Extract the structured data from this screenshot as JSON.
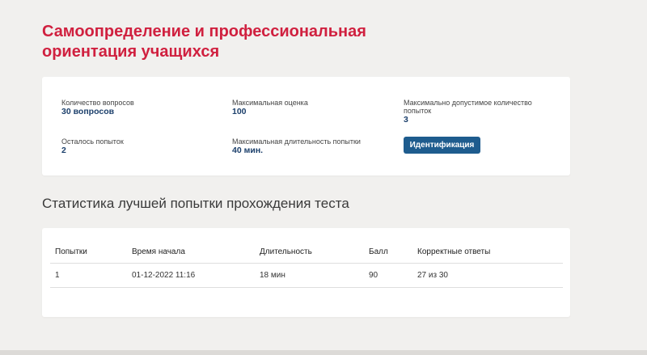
{
  "page": {
    "title": "Самоопределение и профессиональная ориентация учащихся"
  },
  "test_info": {
    "question_count": {
      "label": "Количество вопросов",
      "value": "30 вопросов"
    },
    "max_score": {
      "label": "Максимальная оценка",
      "value": "100"
    },
    "max_attempts": {
      "label": "Максимально допустимое количество попыток",
      "value": "3"
    },
    "attempts_left": {
      "label": "Осталось попыток",
      "value": "2"
    },
    "max_duration": {
      "label": "Максимальная длительность попытки",
      "value": "40 мин."
    },
    "identify_button": "Идентификация"
  },
  "stats": {
    "title": "Статистика лучшей попытки прохождения теста",
    "columns": [
      "Попытки",
      "Время начала",
      "Длительность",
      "Балл",
      "Корректные ответы"
    ],
    "rows": [
      [
        "1",
        "01-12-2022 11:16",
        "18 мин",
        "90",
        "27 из 30"
      ]
    ]
  },
  "colors": {
    "accent_title": "#d0203f",
    "value_text": "#1b3f6b",
    "button_bg": "#1e5c8e",
    "page_bg": "#f1f0ee"
  }
}
